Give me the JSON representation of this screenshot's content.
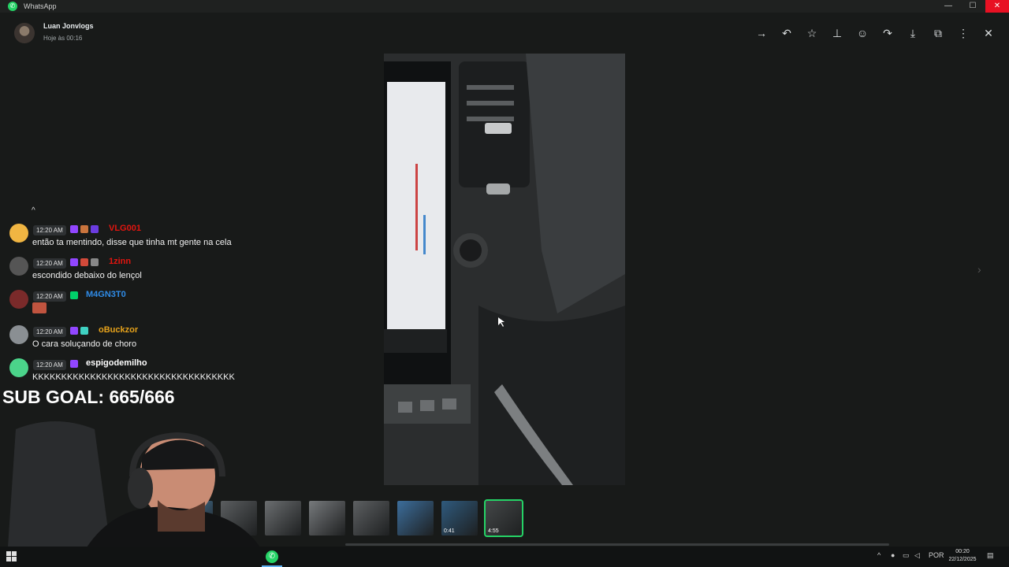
{
  "window": {
    "title": "WhatsApp",
    "controls": {
      "minimize": "—",
      "maximize": "☐",
      "close": "✕"
    }
  },
  "viewer": {
    "sender": "Luan Jonvlogs",
    "timestamp": "Hoje às 00:16",
    "toolbar": [
      {
        "name": "forward-icon",
        "glyph": "→"
      },
      {
        "name": "reply-icon",
        "glyph": "↶"
      },
      {
        "name": "star-icon",
        "glyph": "☆"
      },
      {
        "name": "pin-icon",
        "glyph": "⊥"
      },
      {
        "name": "emoji-icon",
        "glyph": "☺"
      },
      {
        "name": "share-icon",
        "glyph": "↷"
      },
      {
        "name": "download-icon",
        "glyph": "⤓"
      },
      {
        "name": "open-external-icon",
        "glyph": "⧉"
      },
      {
        "name": "more-icon",
        "glyph": "⋮"
      },
      {
        "name": "close-icon",
        "glyph": "✕"
      }
    ],
    "next_glyph": "›",
    "thumbnails": [
      {
        "duration": ""
      },
      {
        "duration": ""
      },
      {
        "duration": ""
      },
      {
        "duration": ""
      },
      {
        "duration": ""
      },
      {
        "duration": ""
      },
      {
        "duration": "0:41"
      },
      {
        "duration": "4:55"
      }
    ],
    "selected_thumbnail": 7
  },
  "chat_overlay": {
    "partial_line": "^",
    "messages": [
      {
        "time": "12:20 AM",
        "user": "VLG001",
        "user_color": "#e3150f",
        "text": "então ta mentindo, disse que tinha mt gente na cela",
        "avatar_color": "#f0b542"
      },
      {
        "time": "12:20 AM",
        "user": "1zinn",
        "user_color": "#e3150f",
        "text": "escondido debaixo do lençol",
        "avatar_color": "#555555"
      },
      {
        "time": "12:20 AM",
        "user": "M4GN3T0",
        "user_color": "#2f8be6",
        "text": "",
        "avatar_color": "#7a2a2a"
      },
      {
        "time": "12:20 AM",
        "user": "oBuckzor",
        "user_color": "#e6a21b",
        "text": "O cara soluçando de choro",
        "avatar_color": "#8a8f93"
      },
      {
        "time": "12:20 AM",
        "user": "espigodemilho",
        "user_color": "#ffffff",
        "text": "KKKKKKKKKKKKKKKKKKKKKKKKKKKKKKKKKKK",
        "avatar_color": "#4bd48a"
      }
    ],
    "sub_goal": "SUB GOAL: 665/666"
  },
  "taskbar": {
    "language": "POR",
    "time": "00:20",
    "date": "22/12/2025"
  },
  "colors": {
    "background": "#181a19",
    "accent": "#25d366",
    "close_red": "#e81123"
  }
}
